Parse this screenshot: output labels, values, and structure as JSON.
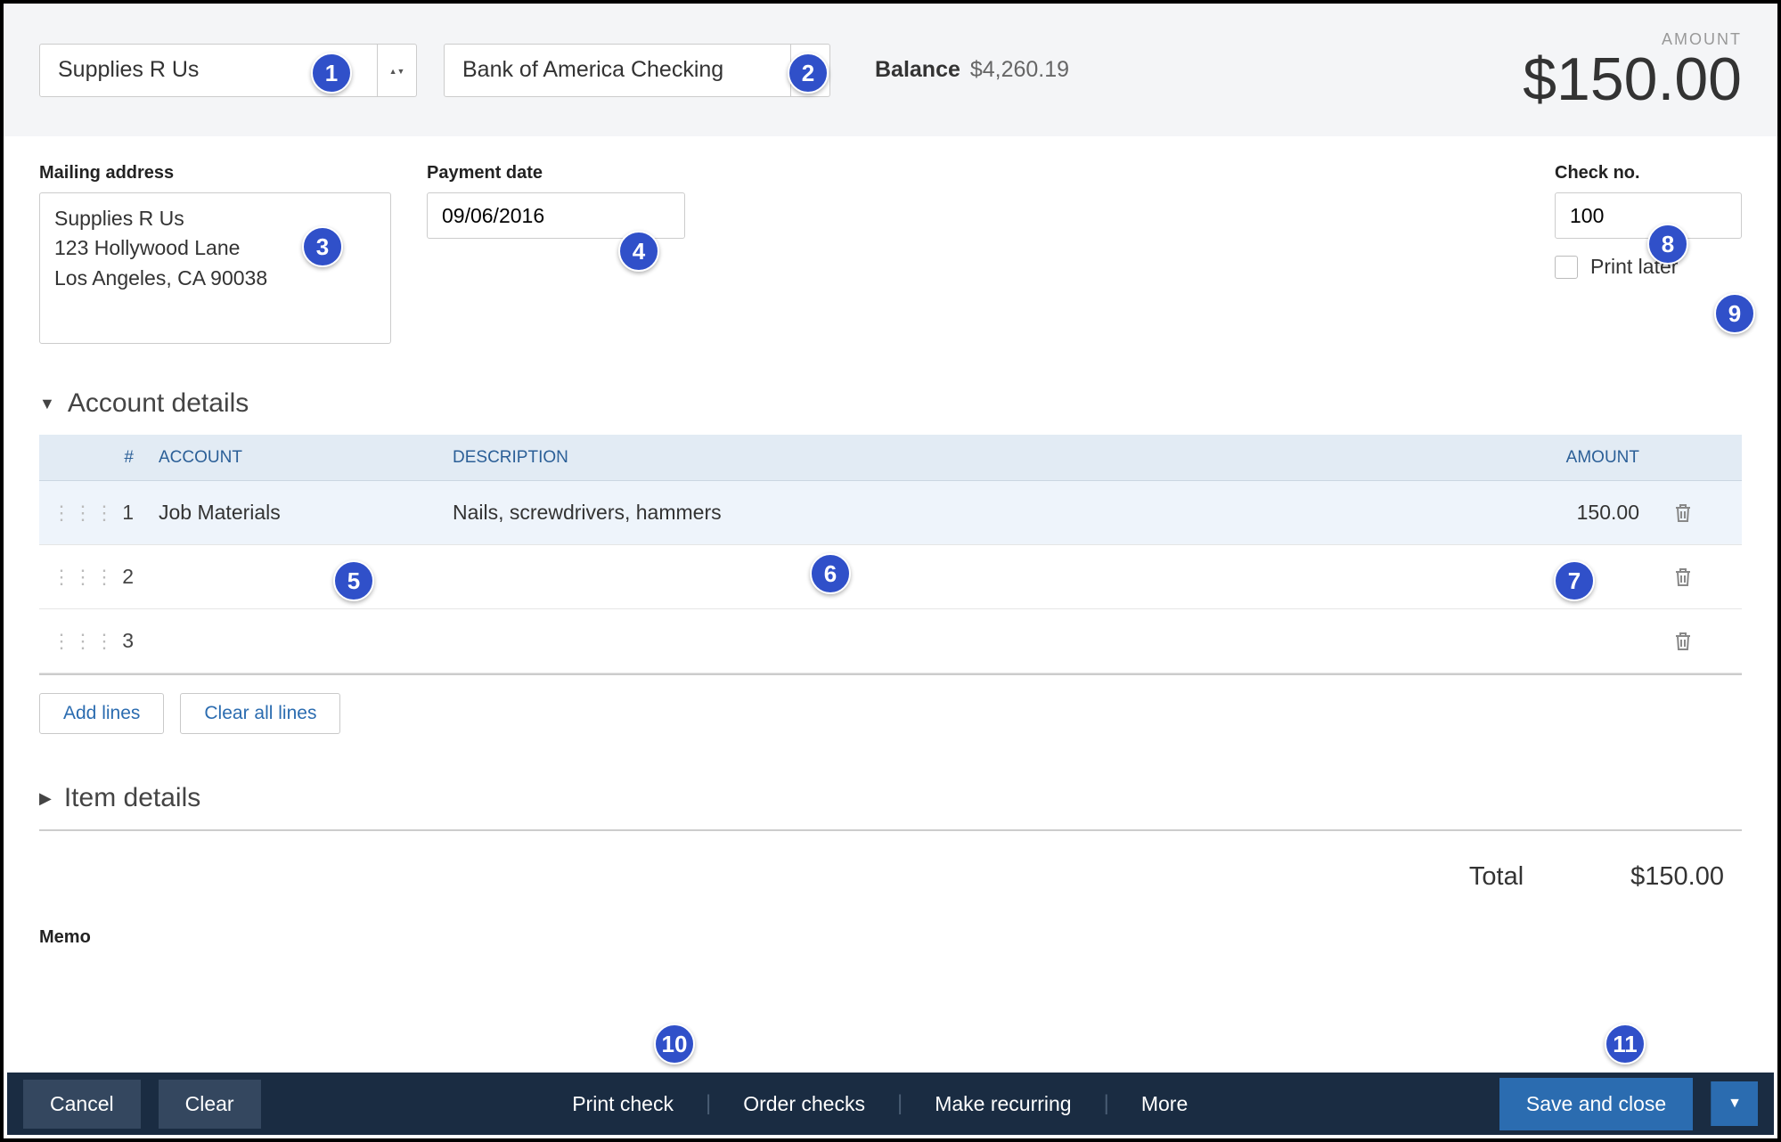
{
  "header": {
    "payee": "Supplies R Us",
    "bank_account": "Bank of America Checking",
    "balance_label": "Balance",
    "balance_value": "$4,260.19",
    "amount_label": "AMOUNT",
    "amount_value": "$150.00"
  },
  "fields": {
    "mailing_label": "Mailing address",
    "mailing_value": "Supplies R Us\n123 Hollywood Lane\nLos Angeles, CA  90038",
    "payment_date_label": "Payment date",
    "payment_date_value": "09/06/2016",
    "check_no_label": "Check no.",
    "check_no_value": "100",
    "print_later_label": "Print later"
  },
  "account_details": {
    "title": "Account details",
    "columns": {
      "num": "#",
      "account": "ACCOUNT",
      "description": "DESCRIPTION",
      "amount": "AMOUNT"
    },
    "rows": [
      {
        "num": "1",
        "account": "Job Materials",
        "description": "Nails, screwdrivers, hammers",
        "amount": "150.00"
      },
      {
        "num": "2",
        "account": "",
        "description": "",
        "amount": ""
      },
      {
        "num": "3",
        "account": "",
        "description": "",
        "amount": ""
      }
    ],
    "add_lines": "Add lines",
    "clear_lines": "Clear all lines"
  },
  "item_details": {
    "title": "Item details"
  },
  "totals": {
    "label": "Total",
    "value": "$150.00"
  },
  "memo": {
    "label": "Memo"
  },
  "footer": {
    "cancel": "Cancel",
    "clear": "Clear",
    "print_check": "Print check",
    "order_checks": "Order checks",
    "make_recurring": "Make recurring",
    "more": "More",
    "save": "Save and close"
  },
  "annotations": [
    "1",
    "2",
    "3",
    "4",
    "5",
    "6",
    "7",
    "8",
    "9",
    "10",
    "11"
  ]
}
